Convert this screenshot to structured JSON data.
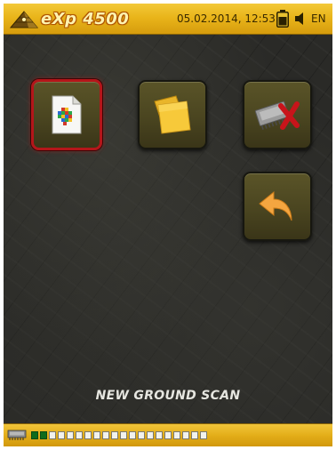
{
  "header": {
    "logo_text": "eXp 4500",
    "datetime": "05.02.2014, 12:53",
    "language": "EN",
    "icons": {
      "battery": "battery-icon",
      "speaker": "speaker-icon"
    }
  },
  "menu": {
    "tiles": [
      {
        "name": "new-scan",
        "icon": "scan-file-icon",
        "selected": true
      },
      {
        "name": "open-files",
        "icon": "files-icon",
        "selected": false
      },
      {
        "name": "delete-memory",
        "icon": "memory-delete-icon",
        "selected": false
      },
      {
        "name": "back",
        "icon": "back-arrow-icon",
        "selected": false
      }
    ]
  },
  "status": {
    "label": "NEW GROUND SCAN"
  },
  "footer": {
    "memory_icon": "memory-chip-icon",
    "memory_slots_total": 20,
    "memory_slots_used": 2
  },
  "colors": {
    "bar_yellow": "#e9b51a",
    "tile_olive": "#4a4520",
    "selected_border": "#b4161a",
    "slot_used": "#0e6b1c"
  }
}
